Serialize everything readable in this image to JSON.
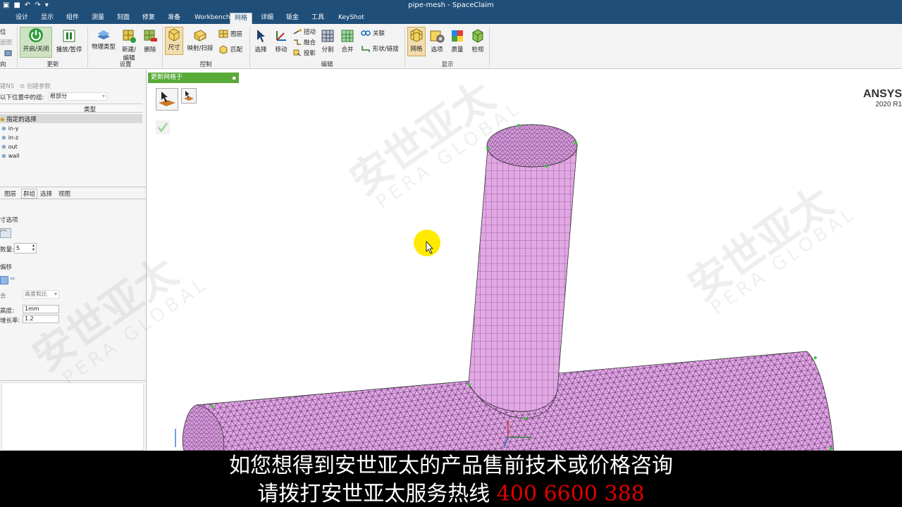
{
  "window": {
    "title": "pipe-mesh - SpaceClaim"
  },
  "tabs": [
    {
      "label": "设计"
    },
    {
      "label": "显示"
    },
    {
      "label": "组件"
    },
    {
      "label": "测量"
    },
    {
      "label": "刻面"
    },
    {
      "label": "修复"
    },
    {
      "label": "准备"
    },
    {
      "label": "Workbench"
    },
    {
      "label": "网格"
    },
    {
      "label": "详细"
    },
    {
      "label": "钣金"
    },
    {
      "label": "工具"
    },
    {
      "label": "KeyShot"
    }
  ],
  "ribbon": {
    "left_cut": {
      "top": "位",
      "mid": "面图",
      "bottom": "向"
    },
    "groups": {
      "update": "更新",
      "setup": "设置",
      "control": "控制",
      "edit": "编辑",
      "display": "显示"
    },
    "buttons": {
      "on_off": "开启/关闭",
      "play_pause": "播放/暂停",
      "physics_type": "物理类型",
      "new_edit": "新建/编辑",
      "delete": "删除",
      "size": "尺寸",
      "map_sweep": "映射/扫掠",
      "layer": "图层",
      "match": "匹配",
      "select": "选择",
      "move": "移动",
      "twist": "扭动",
      "blend": "融合",
      "project": "投影",
      "split": "分割",
      "merge": "合并",
      "associate": "关联",
      "shape_link": "形状/链接",
      "mesh": "网格",
      "options": "选项",
      "quality": "质量",
      "inspect": "检视"
    }
  },
  "leftpanel": {
    "toolbar": {
      "create_ns": "建NS",
      "create_param": "创建参数"
    },
    "group_location_label": "以下位置中的组:",
    "group_location_value": "根部分",
    "col_type": "类型",
    "tree_root": "指定的选择",
    "tree_items": [
      "in-y",
      "in-z",
      "out",
      "wall"
    ],
    "tabs": [
      "图层",
      "群组",
      "选择",
      "视图"
    ],
    "size_options": "寸选项",
    "count_label": "数量:",
    "count_value": "5",
    "offset_label": "偏移",
    "method_label": "去",
    "method_value": "高度和比",
    "height_label": "高度:",
    "height_value": "1mm",
    "growth_label": "增长率:",
    "growth_value": "1.2"
  },
  "viewport": {
    "update_bar": "更新网格于",
    "logo_brand": "ANSYS",
    "logo_version": "2020 R1"
  },
  "watermark": {
    "cn": "安世亚太",
    "en": "PERA GLOBAL"
  },
  "subtitle": {
    "line1": "如您想得到安世亚太的产品售前技术或价格咨询",
    "line2_prefix": "请拨打安世亚太服务热线",
    "line2_phone": "400 6600 388"
  },
  "colors": {
    "titlebar": "#1f4e79",
    "mesh_fill": "#e2a8e4",
    "mesh_line": "#5b2a6a",
    "update_bar": "#5aaa3a",
    "hotline": "#e00000"
  }
}
